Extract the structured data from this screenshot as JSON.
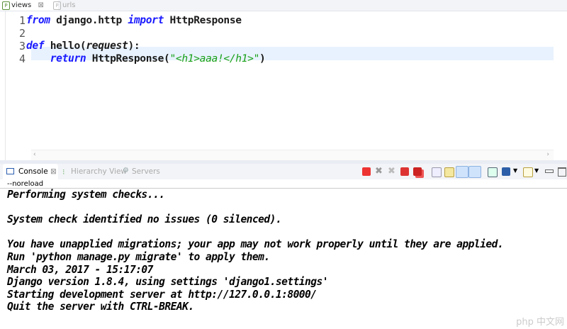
{
  "editor": {
    "tabs": [
      {
        "label": "views",
        "active": true,
        "close": "⊠"
      },
      {
        "label": "urls",
        "active": false
      }
    ],
    "line_numbers": [
      "1",
      "2",
      "3",
      "4"
    ],
    "lines": [
      [
        {
          "t": "from",
          "c": "kw"
        },
        {
          "t": " django.http ",
          "c": ""
        },
        {
          "t": "import",
          "c": "kw"
        },
        {
          "t": " HttpResponse",
          "c": ""
        }
      ],
      [],
      [
        {
          "t": "def",
          "c": "kw"
        },
        {
          "t": " hello(",
          "c": ""
        },
        {
          "t": "request",
          "c": "it"
        },
        {
          "t": "):",
          "c": ""
        }
      ],
      [
        {
          "t": "    ",
          "c": ""
        },
        {
          "t": "return",
          "c": "kw"
        },
        {
          "t": " HttpResponse(",
          "c": ""
        },
        {
          "t": "\"<h1>aaa!</h1>\"",
          "c": "str"
        },
        {
          "t": ")",
          "c": ""
        }
      ]
    ]
  },
  "console_panel": {
    "tabs": [
      {
        "label": "Console",
        "close": "⊠"
      },
      {
        "label": "Hierarchy View"
      },
      {
        "label": "Servers"
      }
    ],
    "process_label": "--noreload",
    "output": [
      "Performing system checks...",
      "",
      "System check identified no issues (0 silenced).",
      "",
      "You have unapplied migrations; your app may not work properly until they are applied.",
      "Run 'python manage.py migrate' to apply them.",
      "March 03, 2017 - 15:17:07",
      "Django version 1.8.4, using settings 'django1.settings'",
      "Starting development server at http://127.0.0.1:8000/",
      "Quit the server with CTRL-BREAK."
    ]
  },
  "toolbar_icons": [
    "terminate-icon",
    "remove-launch-icon",
    "remove-all-icon",
    "terminate-relaunch-icon",
    "terminate-all-icon",
    "clear-console-icon",
    "scroll-lock-icon",
    "show-on-stdout-icon",
    "show-on-stderr-icon",
    "pin-console-icon",
    "display-console-icon",
    "open-console-icon",
    "minimize-icon",
    "maximize-icon"
  ],
  "watermark": "php 中文网"
}
